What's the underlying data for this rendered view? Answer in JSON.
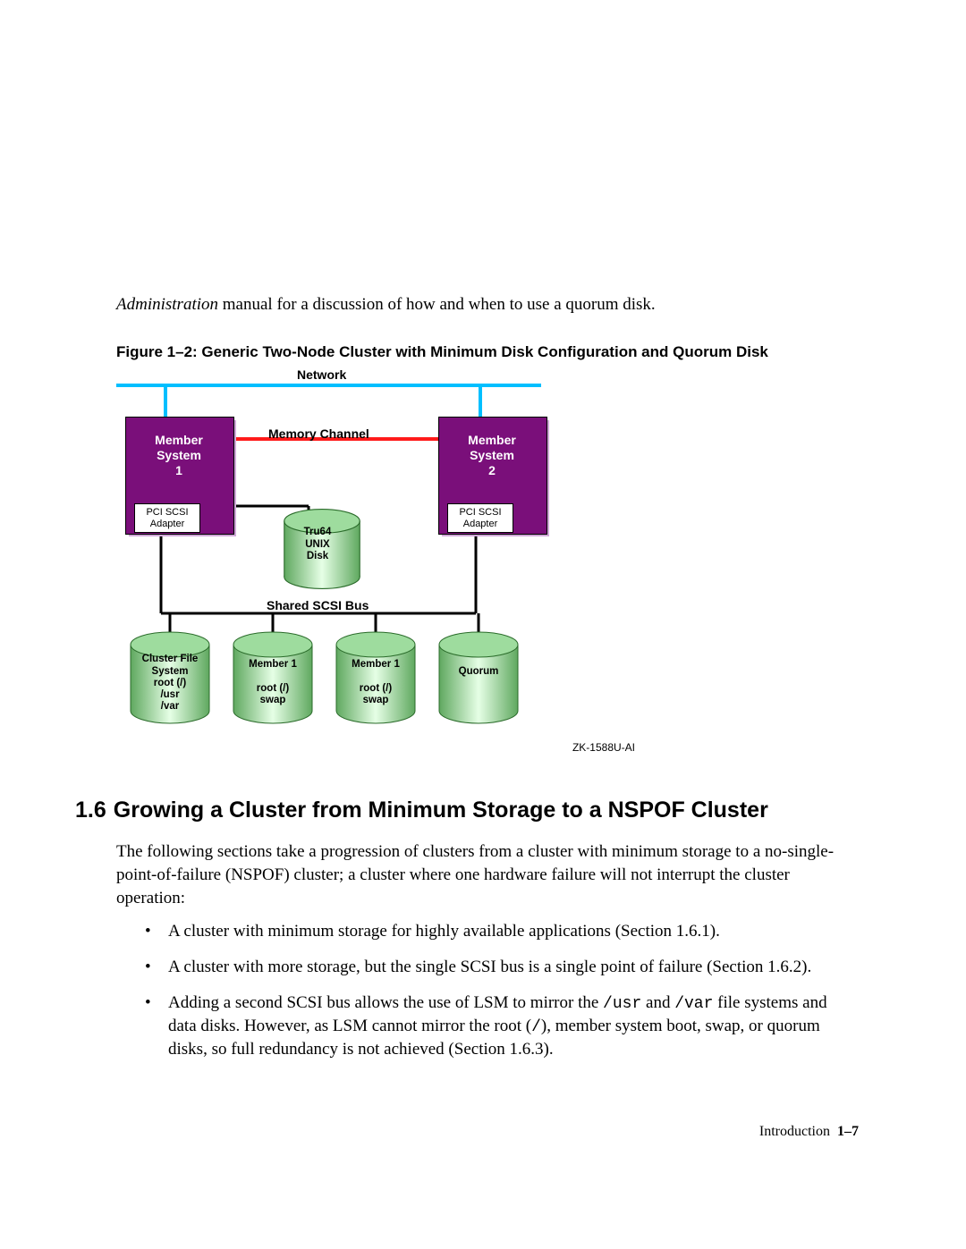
{
  "intro": {
    "italic": "Administration",
    "rest": " manual for a discussion of how and when to use a quorum disk."
  },
  "figure_caption": "Figure 1–2: Generic Two-Node Cluster with Minimum Disk Configuration and Quorum Disk",
  "diagram": {
    "network_label": "Network",
    "memory_channel_label": "Memory Channel",
    "shared_bus_label": "Shared SCSI Bus",
    "member1": "Member\nSystem\n1",
    "member2": "Member\nSystem\n2",
    "adapter1": "PCI SCSI\nAdapter",
    "adapter2": "PCI SCSI\nAdapter",
    "tru64_disk": "Tru64\nUNIX\nDisk",
    "disk1": "Cluster File\nSystem\nroot (/)\n/usr\n/var",
    "disk2": "Member 1\n\nroot (/)\nswap",
    "disk3": "Member 1\n\nroot (/)\nswap",
    "disk4": "Quorum",
    "zkid": "ZK-1588U-AI"
  },
  "section": {
    "number": "1.6",
    "title": "Growing a Cluster from Minimum Storage to a NSPOF Cluster"
  },
  "paragraph1": "The following sections take a progression of clusters from a cluster with minimum storage to a no-single-point-of-failure (NSPOF) cluster; a cluster where one hardware failure will not interrupt the cluster operation:",
  "bullets": [
    {
      "text": "A cluster with minimum storage for highly available applications (Section 1.6.1)."
    },
    {
      "text": "A cluster with more storage, but the single SCSI bus is a single point of failure (Section 1.6.2)."
    },
    {
      "pre": "Adding a second SCSI bus allows the use of LSM to mirror the ",
      "code1": "/usr",
      "mid1": " and ",
      "code2": "/var",
      "mid2": " file systems and data disks. However, as LSM cannot mirror the root (",
      "code3": "/",
      "post": "), member system boot, swap, or quorum disks, so full redundancy is not achieved (Section 1.6.3)."
    }
  ],
  "footer": {
    "label": "Introduction",
    "page": "1–7"
  }
}
